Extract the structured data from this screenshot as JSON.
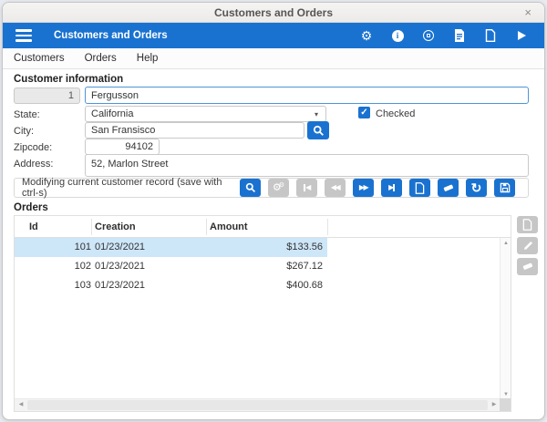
{
  "window": {
    "title": "Customers and Orders",
    "close_glyph": "×"
  },
  "app_toolbar": {
    "title": "Customers and Orders",
    "icons": [
      "menu",
      "settings-gear",
      "info",
      "advanced-settings",
      "report-document",
      "new-document",
      "run"
    ]
  },
  "menubar": {
    "items": [
      "Customers",
      "Orders",
      "Help"
    ]
  },
  "customer_form": {
    "section_title": "Customer information",
    "id_value": "1",
    "name_value": "Fergusson",
    "state_label": "State:",
    "state_value": "California",
    "checkbox_label": "Checked",
    "checkbox_checked": true,
    "city_label": "City:",
    "city_value": "San Fransisco",
    "zipcode_label": "Zipcode:",
    "zipcode_value": "94102",
    "address_label": "Address:",
    "address_value": "52, Marlon Street"
  },
  "record_status": {
    "message": "Modifying current customer record (save with ctrl-s)",
    "buttons": [
      {
        "name": "search-record",
        "enabled": true
      },
      {
        "name": "batch-operations",
        "enabled": false
      },
      {
        "name": "first-record",
        "enabled": false
      },
      {
        "name": "previous-record",
        "enabled": false
      },
      {
        "name": "next-record",
        "enabled": true
      },
      {
        "name": "last-record",
        "enabled": true
      },
      {
        "name": "new-record",
        "enabled": true
      },
      {
        "name": "delete-record",
        "enabled": true
      },
      {
        "name": "refresh-record",
        "enabled": true
      },
      {
        "name": "save-record",
        "enabled": true
      }
    ]
  },
  "orders": {
    "section_title": "Orders",
    "columns": [
      "Id",
      "Creation",
      "Amount"
    ],
    "rows": [
      {
        "id": "101",
        "creation": "01/23/2021",
        "amount": "$133.56",
        "selected": true
      },
      {
        "id": "102",
        "creation": "01/23/2021",
        "amount": "$267.12",
        "selected": false
      },
      {
        "id": "103",
        "creation": "01/23/2021",
        "amount": "$400.68",
        "selected": false
      }
    ],
    "side_buttons": [
      {
        "name": "new-order",
        "enabled": false
      },
      {
        "name": "edit-order",
        "enabled": false
      },
      {
        "name": "delete-order",
        "enabled": false
      }
    ]
  },
  "colors": {
    "accent": "#1a72d0",
    "selected_row": "#cde6f8",
    "disabled_button": "#c6c6c6",
    "focused_border": "#4e94d8"
  }
}
